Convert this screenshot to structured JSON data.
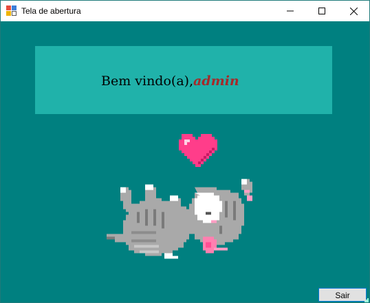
{
  "window": {
    "title": "Tela de abertura",
    "app_icon": "windows-form-icon",
    "controls": [
      "minimize-icon",
      "maximize-icon",
      "close-icon"
    ]
  },
  "colors": {
    "client_background": "#008080",
    "panel_background": "#20b2aa",
    "username_color": "#a52a2a",
    "heart": "#ff3d8a",
    "cat_body": "#a9a9a9"
  },
  "welcome": {
    "greeting": "Bem vindo(a),",
    "username": "admin"
  },
  "illustration": {
    "heart": "heart-icon",
    "cat": "pixel-cat-image"
  },
  "buttons": {
    "exit_label": "Sair"
  }
}
